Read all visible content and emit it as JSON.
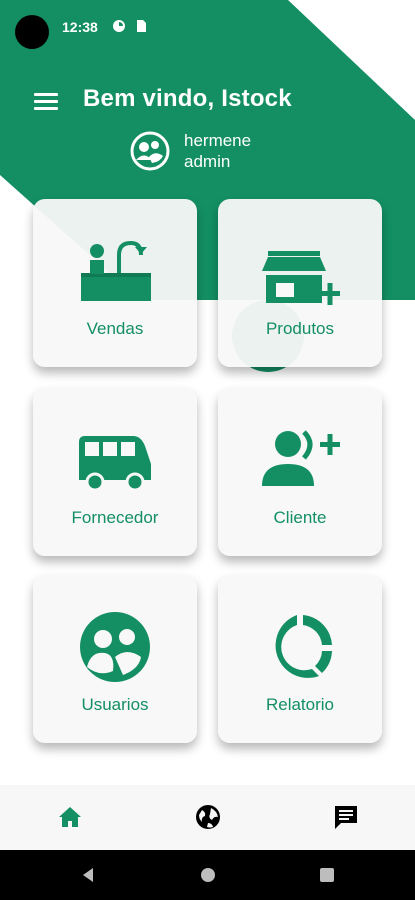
{
  "status_bar": {
    "time": "12:38"
  },
  "header": {
    "welcome_text": "Bem vindo, Istock"
  },
  "user": {
    "name": "hermene",
    "role": "admin"
  },
  "cards": [
    {
      "label": "Vendas",
      "icon": "sales-basket-icon"
    },
    {
      "label": "Produtos",
      "icon": "store-add-icon"
    },
    {
      "label": "Fornecedor",
      "icon": "van-icon"
    },
    {
      "label": "Cliente",
      "icon": "person-add-icon"
    },
    {
      "label": "Usuarios",
      "icon": "group-icon"
    },
    {
      "label": "Relatorio",
      "icon": "donut-chart-icon"
    }
  ],
  "bottom_nav": {
    "items": [
      {
        "icon": "home-icon",
        "active": true
      },
      {
        "icon": "globe-icon",
        "active": false
      },
      {
        "icon": "chat-icon",
        "active": false
      }
    ]
  },
  "colors": {
    "primary": "#138f63",
    "card_bg": "#f8f8f8",
    "nav_bg": "#f7f7f7"
  }
}
